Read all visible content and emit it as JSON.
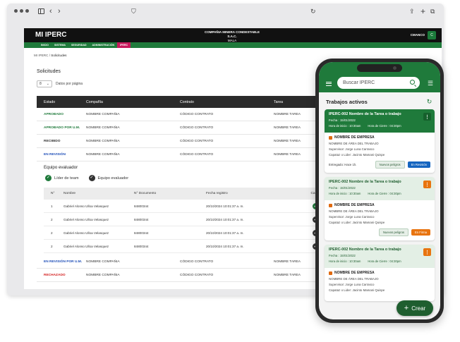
{
  "app": {
    "title": "MI IPERC",
    "company_line1": "COMPAÑIA MINERA CONDESTABLE S.A.C.",
    "company_line2": "MALA",
    "user_name": "CMANCO",
    "user_initial": "C"
  },
  "nav": [
    "INICIO",
    "SISTEMA",
    "SEGURIDAD",
    "ADMINISTRACIÓN",
    "IPERC"
  ],
  "breadcrumb": {
    "root": "MI IPERC",
    "separator": "/",
    "current": "Solicitudes"
  },
  "page": {
    "title": "Solicitudes",
    "page_size": "8",
    "page_size_label": "Datos por página"
  },
  "table": {
    "headers": [
      "Estado",
      "Compañía",
      "Contrato",
      "Tarea"
    ],
    "rows": [
      {
        "estado": "APROBADO",
        "color": "#1f7a3b",
        "compania": "NOMBRE COMPAÑIA",
        "contrato": "CÓDIGO CONTRATO",
        "tarea": "NOMBRE TAREA"
      },
      {
        "estado": "APROBADO POR U.M.",
        "color": "#1f7a3b",
        "compania": "NOMBRE COMPAÑIA",
        "contrato": "CÓDIGO CONTRATO",
        "tarea": "NOMBRE TAREA"
      },
      {
        "estado": "RECIBIDO",
        "color": "#333333",
        "compania": "NOMBRE COMPAÑIA",
        "contrato": "CÓDIGO CONTRATO",
        "tarea": "NOMBRE TAREA"
      },
      {
        "estado": "EN REVISIÓN",
        "color": "#1f4fb8",
        "compania": "NOMBRE COMPAÑIA",
        "contrato": "CÓDIGO CONTRATO",
        "tarea": "NOMBRE TAREA"
      }
    ],
    "rows_after": [
      {
        "estado": "EN REVISIÓN POR U.M.",
        "color": "#1f4fb8",
        "compania": "NOMBRE COMPAÑIA",
        "contrato": "CÓDIGO CONTRATO",
        "tarea": "NOMBRE TAREA"
      },
      {
        "estado": "RECHAZADO",
        "color": "#d42020",
        "compania": "NOMBRE COMPAÑIA",
        "contrato": "CÓDIGO CONTRATO",
        "tarea": "NOMBRE TAREA"
      }
    ]
  },
  "team": {
    "title": "Equipo evaluador",
    "legend_leader": "Líder de team",
    "legend_team": "Equipo evaluador",
    "headers": [
      "N°",
      "Nombre",
      "N° Documento",
      "Fecha registro",
      "Cargo"
    ],
    "rows": [
      {
        "n": "1",
        "nombre": "Gabriel Alonso Ulloa Velasquez",
        "doc": "84800344",
        "fecha": "20/10/2024 10:01:37 a. m.",
        "cargo": "leader"
      },
      {
        "n": "2",
        "nombre": "Gabriel Alonso Ulloa Velasquez",
        "doc": "84800344",
        "fecha": "20/10/2024 10:01:37 a. m.",
        "cargo": "team"
      },
      {
        "n": "2",
        "nombre": "Gabriel Alonso Ulloa Velasquez",
        "doc": "84800344",
        "fecha": "20/10/2024 10:01:37 a. m.",
        "cargo": "team"
      },
      {
        "n": "2",
        "nombre": "Gabriel Alonso Ulloa Velasquez",
        "doc": "84800344",
        "fecha": "20/10/2024 10:01:37 a. m.",
        "cargo": "team"
      }
    ]
  },
  "phone": {
    "search_placeholder": "Buscar IPERC",
    "section_title": "Trabajos activos",
    "fab_label": "Crear",
    "cards": [
      {
        "title": "IPERC-002 Nombre de la Tarea o trabajo",
        "fecha": "Fecha : 15/01/2022",
        "inicio": "Hora de inicio : 10:30am",
        "cierre": "Hora de Cierre : 04:30pm",
        "empresa": "NOMBRE DE EMPRESA",
        "area": "NOMBRE DE ÁREA DEL TRABAJO",
        "supervisor": "Supervisor: Jorge Luna Carrasco",
        "capataz": "Capataz o Lider: Jacinto Mamani Quispe",
        "entregado": "Entregado: Hace 1h.",
        "peligros": "Nuevos peligros",
        "status": "En Revisión",
        "status_color": "#1565c0",
        "head_style": "green",
        "kebab_color": "#15602c"
      },
      {
        "title": "IPERC-002 Nombre de la Tarea o trabajo",
        "fecha": "Fecha : 15/01/2022",
        "inicio": "Hora de inicio : 10:30am",
        "cierre": "Hora de Cierre : 04:30pm",
        "empresa": "NOMBRE DE EMPRESA",
        "area": "NOMBRE DE ÁREA DEL TRABAJO",
        "supervisor": "Supervisor: Jorge Luna Carrasco",
        "capataz": "Capataz o Lider: Jacinto Mamani Quispe",
        "entregado": "",
        "peligros": "Nuevos peligros",
        "status": "En Firma",
        "status_color": "#e8740f",
        "head_style": "light",
        "kebab_color": "#e8740f"
      },
      {
        "title": "IPERC-002 Nombre de la Tarea o trabajo",
        "fecha": "Fecha : 15/01/2022",
        "inicio": "Hora de inicio : 10:30am",
        "cierre": "Hora de Cierre : 04:30pm",
        "empresa": "NOMBRE DE EMPRESA",
        "area": "NOMBRE DE ÁREA DEL TRABAJO",
        "supervisor": "Supervisor: Jorge Luna Carrasco",
        "capataz": "Capataz o Lider: Jacinto Mamani Quispe",
        "entregado": "",
        "peligros": "",
        "status": "",
        "status_color": "#e8740f",
        "head_style": "light",
        "kebab_color": "#e8740f"
      }
    ]
  },
  "colors": {
    "brand": "#1f7a3b",
    "accent_nav": "#c7195c",
    "dark": "#2b2b2b"
  }
}
